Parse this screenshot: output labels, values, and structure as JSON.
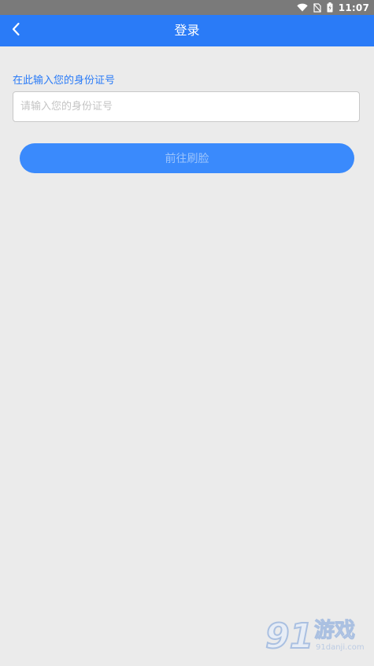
{
  "status_bar": {
    "time": "11:07",
    "icons": [
      "wifi-icon",
      "no-sim-icon",
      "battery-icon"
    ]
  },
  "app_bar": {
    "title": "登录",
    "back_icon": "chevron-left-icon"
  },
  "form": {
    "label": "在此输入您的身份证号",
    "id_input": {
      "value": "",
      "placeholder": "请输入您的身份证号"
    },
    "submit_label": "前往刷脸"
  },
  "watermark": {
    "digits": "91",
    "name": "游戏",
    "url": "91danji.com"
  },
  "colors": {
    "primary": "#2a7bf7",
    "button": "#3a8afc",
    "button_text": "#9cc4fb",
    "background": "#ebebeb",
    "status_bar": "#7a7a7a"
  }
}
